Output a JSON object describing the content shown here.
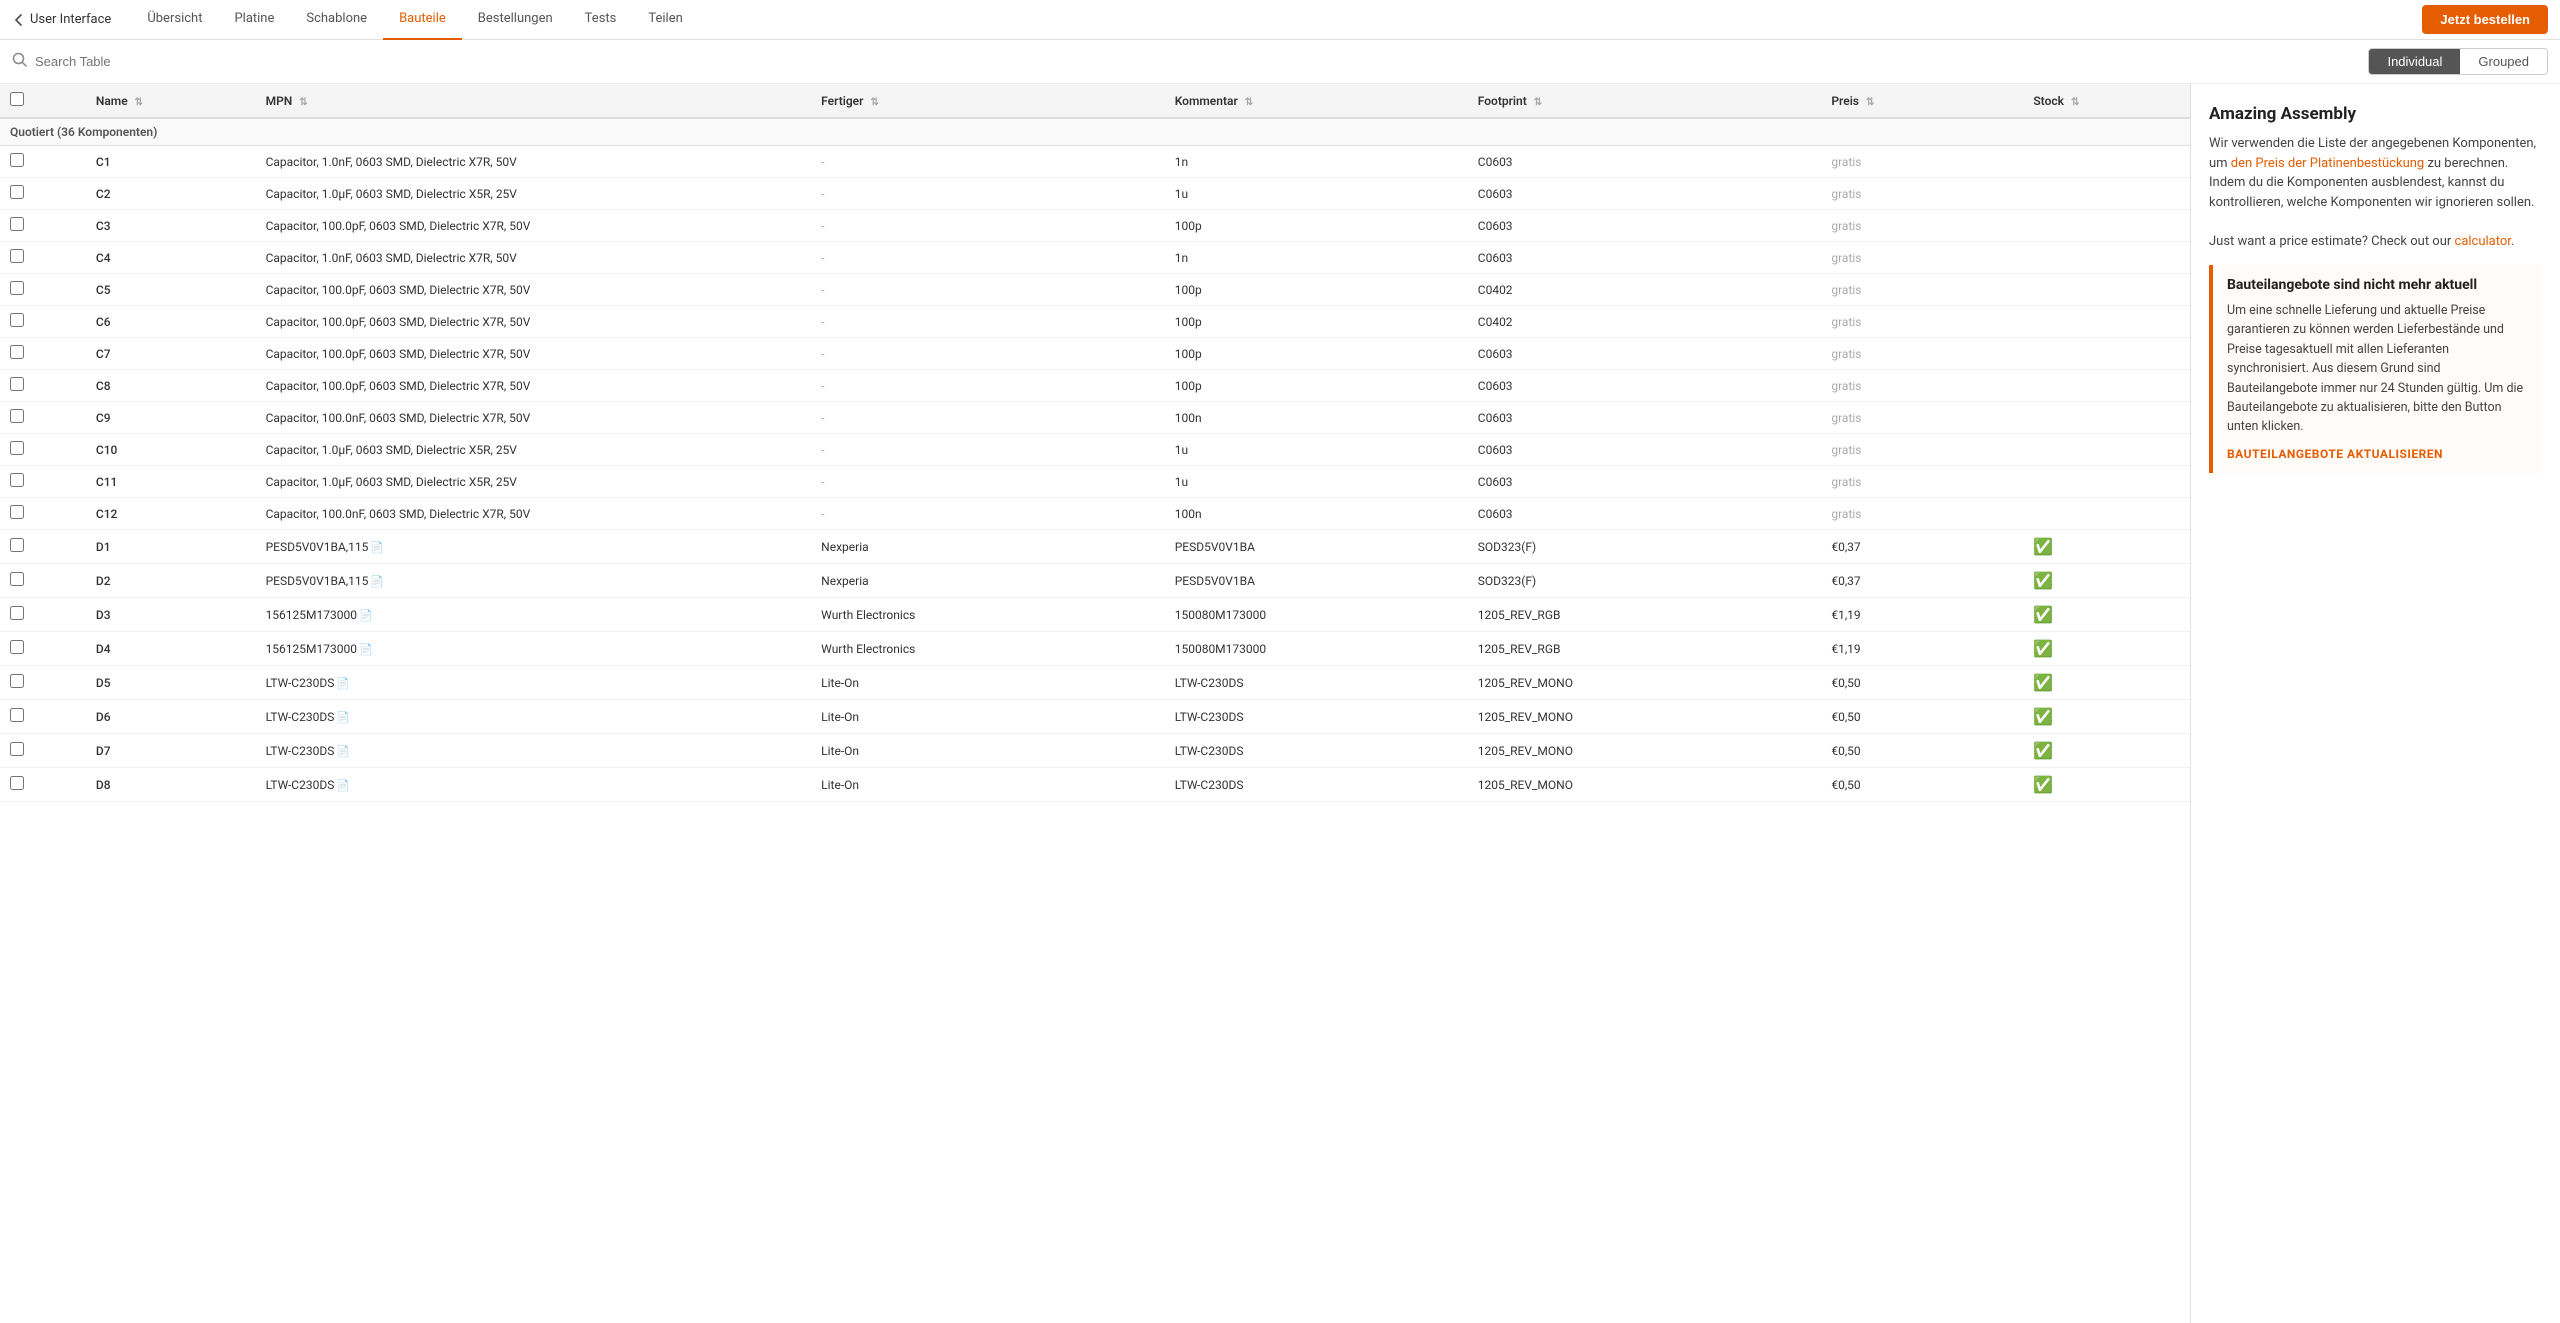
{
  "nav": {
    "back_label": "User Interface",
    "tabs": [
      {
        "id": "ubersicht",
        "label": "Übersicht",
        "active": false
      },
      {
        "id": "platine",
        "label": "Platine",
        "active": false
      },
      {
        "id": "schablone",
        "label": "Schablone",
        "active": false
      },
      {
        "id": "bauteile",
        "label": "Bauteile",
        "active": true
      },
      {
        "id": "bestellungen",
        "label": "Bestellungen",
        "active": false
      },
      {
        "id": "tests",
        "label": "Tests",
        "active": false
      },
      {
        "id": "teilen",
        "label": "Teilen",
        "active": false
      }
    ],
    "order_button": "Jetzt bestellen"
  },
  "search": {
    "placeholder": "Search Table"
  },
  "toggle": {
    "individual_label": "Individual",
    "grouped_label": "Grouped"
  },
  "table": {
    "columns": {
      "name": "Name",
      "mpn": "MPN",
      "fertiger": "Fertiger",
      "kommentar": "Kommentar",
      "footprint": "Footprint",
      "preis": "Preis",
      "stock": "Stock"
    },
    "group_header": "Quotiert (36 Komponenten)",
    "rows": [
      {
        "name": "C1",
        "mpn": "Capacitor, 1.0nF, 0603 SMD, Dielectric X7R, 50V",
        "mpn_has_doc": false,
        "fertiger": "-",
        "kommentar": "1n",
        "footprint": "C0603",
        "preis": "gratis",
        "stock": ""
      },
      {
        "name": "C2",
        "mpn": "Capacitor, 1.0µF, 0603 SMD, Dielectric X5R, 25V",
        "mpn_has_doc": false,
        "fertiger": "-",
        "kommentar": "1u",
        "footprint": "C0603",
        "preis": "gratis",
        "stock": ""
      },
      {
        "name": "C3",
        "mpn": "Capacitor, 100.0pF, 0603 SMD, Dielectric X7R, 50V",
        "mpn_has_doc": false,
        "fertiger": "-",
        "kommentar": "100p",
        "footprint": "C0603",
        "preis": "gratis",
        "stock": ""
      },
      {
        "name": "C4",
        "mpn": "Capacitor, 1.0nF, 0603 SMD, Dielectric X7R, 50V",
        "mpn_has_doc": false,
        "fertiger": "-",
        "kommentar": "1n",
        "footprint": "C0603",
        "preis": "gratis",
        "stock": ""
      },
      {
        "name": "C5",
        "mpn": "Capacitor, 100.0pF, 0603 SMD, Dielectric X7R, 50V",
        "mpn_has_doc": false,
        "fertiger": "-",
        "kommentar": "100p",
        "footprint": "C0402",
        "preis": "gratis",
        "stock": ""
      },
      {
        "name": "C6",
        "mpn": "Capacitor, 100.0pF, 0603 SMD, Dielectric X7R, 50V",
        "mpn_has_doc": false,
        "fertiger": "-",
        "kommentar": "100p",
        "footprint": "C0402",
        "preis": "gratis",
        "stock": ""
      },
      {
        "name": "C7",
        "mpn": "Capacitor, 100.0pF, 0603 SMD, Dielectric X7R, 50V",
        "mpn_has_doc": false,
        "fertiger": "-",
        "kommentar": "100p",
        "footprint": "C0603",
        "preis": "gratis",
        "stock": ""
      },
      {
        "name": "C8",
        "mpn": "Capacitor, 100.0pF, 0603 SMD, Dielectric X7R, 50V",
        "mpn_has_doc": false,
        "fertiger": "-",
        "kommentar": "100p",
        "footprint": "C0603",
        "preis": "gratis",
        "stock": ""
      },
      {
        "name": "C9",
        "mpn": "Capacitor, 100.0nF, 0603 SMD, Dielectric X7R, 50V",
        "mpn_has_doc": false,
        "fertiger": "-",
        "kommentar": "100n",
        "footprint": "C0603",
        "preis": "gratis",
        "stock": ""
      },
      {
        "name": "C10",
        "mpn": "Capacitor, 1.0µF, 0603 SMD, Dielectric X5R, 25V",
        "mpn_has_doc": false,
        "fertiger": "-",
        "kommentar": "1u",
        "footprint": "C0603",
        "preis": "gratis",
        "stock": ""
      },
      {
        "name": "C11",
        "mpn": "Capacitor, 1.0µF, 0603 SMD, Dielectric X5R, 25V",
        "mpn_has_doc": false,
        "fertiger": "-",
        "kommentar": "1u",
        "footprint": "C0603",
        "preis": "gratis",
        "stock": ""
      },
      {
        "name": "C12",
        "mpn": "Capacitor, 100.0nF, 0603 SMD, Dielectric X7R, 50V",
        "mpn_has_doc": false,
        "fertiger": "-",
        "kommentar": "100n",
        "footprint": "C0603",
        "preis": "gratis",
        "stock": ""
      },
      {
        "name": "D1",
        "mpn": "PESD5V0V1BA,115",
        "mpn_has_doc": true,
        "fertiger": "Nexperia",
        "kommentar": "PESD5V0V1BA",
        "footprint": "SOD323(F)",
        "preis": "€0,37",
        "stock": "ok"
      },
      {
        "name": "D2",
        "mpn": "PESD5V0V1BA,115",
        "mpn_has_doc": true,
        "fertiger": "Nexperia",
        "kommentar": "PESD5V0V1BA",
        "footprint": "SOD323(F)",
        "preis": "€0,37",
        "stock": "ok"
      },
      {
        "name": "D3",
        "mpn": "156125M173000",
        "mpn_has_doc": true,
        "fertiger": "Wurth Electronics",
        "kommentar": "150080M173000",
        "footprint": "1205_REV_RGB",
        "preis": "€1,19",
        "stock": "ok"
      },
      {
        "name": "D4",
        "mpn": "156125M173000",
        "mpn_has_doc": true,
        "fertiger": "Wurth Electronics",
        "kommentar": "150080M173000",
        "footprint": "1205_REV_RGB",
        "preis": "€1,19",
        "stock": "ok"
      },
      {
        "name": "D5",
        "mpn": "LTW-C230DS",
        "mpn_has_doc": true,
        "fertiger": "Lite-On",
        "kommentar": "LTW-C230DS",
        "footprint": "1205_REV_MONO",
        "preis": "€0,50",
        "stock": "ok"
      },
      {
        "name": "D6",
        "mpn": "LTW-C230DS",
        "mpn_has_doc": true,
        "fertiger": "Lite-On",
        "kommentar": "LTW-C230DS",
        "footprint": "1205_REV_MONO",
        "preis": "€0,50",
        "stock": "ok"
      },
      {
        "name": "D7",
        "mpn": "LTW-C230DS",
        "mpn_has_doc": true,
        "fertiger": "Lite-On",
        "kommentar": "LTW-C230DS",
        "footprint": "1205_REV_MONO",
        "preis": "€0,50",
        "stock": "ok"
      },
      {
        "name": "D8",
        "mpn": "LTW-C230DS",
        "mpn_has_doc": true,
        "fertiger": "Lite-On",
        "kommentar": "LTW-C230DS",
        "footprint": "1205_REV_MONO",
        "preis": "€0,50",
        "stock": "ok"
      }
    ]
  },
  "sidebar": {
    "title": "Amazing Assembly",
    "body_text1": "Wir verwenden die Liste der angegebenen Komponenten, um ",
    "body_link1": "den Preis der Platinenbestückung",
    "body_text2": " zu berechnen. Indem du die Komponenten ausblendest, kannst du kontrollieren, welche Komponenten wir ignorieren sollen.",
    "body_text3": "Just want a price estimate? Check out our ",
    "body_link2": "calculator",
    "body_text4": ".",
    "warning": {
      "title": "Bauteilangebote sind nicht mehr aktuell",
      "body": "Um eine schnelle Lieferung und aktuelle Preise garantieren zu können werden Lieferbestände und Preise tagesaktuell mit allen Lieferanten synchronisiert. Aus diesem Grund sind Bauteilangebote immer nur 24 Stunden gültig. Um die Bauteilangebote zu aktualisieren, bitte den Button unten klicken.",
      "action": "BAUTEILANGEBOTE AKTUALISIEREN"
    }
  }
}
